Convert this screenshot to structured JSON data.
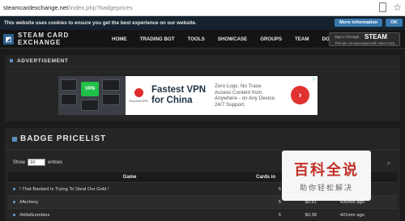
{
  "browser": {
    "url_domain": "steamcardexchange.net",
    "url_path": "/index.php?badgeprices"
  },
  "cookie_notice": {
    "text": "This website uses cookies to ensure you get the best experience on our website.",
    "more_info": "More information",
    "ok": "OK"
  },
  "nav": {
    "site_title": "STEAM CARD EXCHANGE",
    "links": [
      "HOME",
      "TRADING BOT",
      "TOOLS",
      "SHOWCASE",
      "GROUPS",
      "TEAM",
      "DONATION"
    ],
    "signin_top": "Sign in through",
    "signin_brand": "STEAM",
    "signin_sub": "This site not associated with Valve Corp."
  },
  "advertisement": {
    "title": "ADVERTISEMENT",
    "key_label": "VPN",
    "brand": "ExpressVPN",
    "headline": "Fastest VPN for China",
    "body": "Zero Logs. No Trace. Access Content from Anywhere - on Any Device. 24/7 Support.",
    "arrow": "›"
  },
  "pricelist": {
    "title": "BADGE PRICELIST",
    "show_label": "Show",
    "show_value": "10",
    "entries_label": "entries",
    "columns": {
      "game": "Game",
      "cards": "Cards in"
    },
    "rows": [
      {
        "game": "! That Bastard Is Trying To Steal Our Gold !",
        "cards": "5",
        "price": "",
        "time": ""
      },
      {
        "game": "#Archery",
        "cards": "5",
        "price": "$0.81",
        "time": "436min ago"
      },
      {
        "game": "#killallzombies",
        "cards": "5",
        "price": "$0.38",
        "time": "421min ago"
      }
    ]
  },
  "watermark": {
    "main": "百科全说",
    "sub": "助你轻松解决"
  }
}
